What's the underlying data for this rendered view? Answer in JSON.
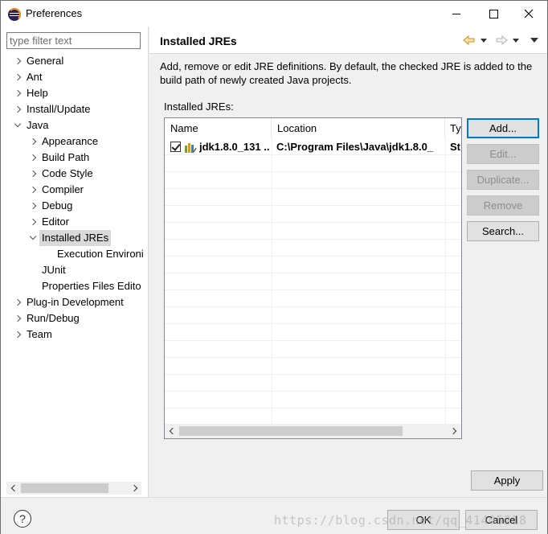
{
  "window": {
    "title": "Preferences",
    "icon": "eclipse-icon"
  },
  "filter": {
    "placeholder": "type filter text"
  },
  "tree": {
    "items": [
      {
        "label": "General",
        "level": 0,
        "state": "collapsed"
      },
      {
        "label": "Ant",
        "level": 0,
        "state": "collapsed"
      },
      {
        "label": "Help",
        "level": 0,
        "state": "collapsed"
      },
      {
        "label": "Install/Update",
        "level": 0,
        "state": "collapsed"
      },
      {
        "label": "Java",
        "level": 0,
        "state": "expanded"
      },
      {
        "label": "Appearance",
        "level": 1,
        "state": "collapsed"
      },
      {
        "label": "Build Path",
        "level": 1,
        "state": "collapsed"
      },
      {
        "label": "Code Style",
        "level": 1,
        "state": "collapsed"
      },
      {
        "label": "Compiler",
        "level": 1,
        "state": "collapsed"
      },
      {
        "label": "Debug",
        "level": 1,
        "state": "collapsed"
      },
      {
        "label": "Editor",
        "level": 1,
        "state": "collapsed"
      },
      {
        "label": "Installed JREs",
        "level": 1,
        "state": "expanded",
        "selected": true
      },
      {
        "label": "Execution Environi",
        "level": 2,
        "state": "leaf"
      },
      {
        "label": "JUnit",
        "level": 1,
        "state": "leaf"
      },
      {
        "label": "Properties Files Edito",
        "level": 1,
        "state": "leaf"
      },
      {
        "label": "Plug-in Development",
        "level": 0,
        "state": "collapsed"
      },
      {
        "label": "Run/Debug",
        "level": 0,
        "state": "collapsed"
      },
      {
        "label": "Team",
        "level": 0,
        "state": "collapsed"
      }
    ]
  },
  "page": {
    "title": "Installed JREs",
    "description": "Add, remove or edit JRE definitions. By default, the checked JRE is added to the build path of newly created Java projects.",
    "list_label": "Installed JREs:"
  },
  "table": {
    "columns": [
      "Name",
      "Location",
      "Ty"
    ],
    "rows": [
      {
        "checked": true,
        "name": "jdk1.8.0_131 ...",
        "location": "C:\\Program Files\\Java\\jdk1.8.0_",
        "type": "St"
      }
    ]
  },
  "buttons": {
    "add": "Add...",
    "edit": "Edit...",
    "duplicate": "Duplicate...",
    "remove": "Remove",
    "search": "Search...",
    "apply": "Apply",
    "ok": "OK",
    "cancel": "Cancel"
  },
  "watermark": "https://blog.csdn.net/qq_41405218",
  "colors": {
    "selection": "#d9d9d9",
    "default_button_border": "#0078d7",
    "nav_arrow": "#e8a33c"
  }
}
